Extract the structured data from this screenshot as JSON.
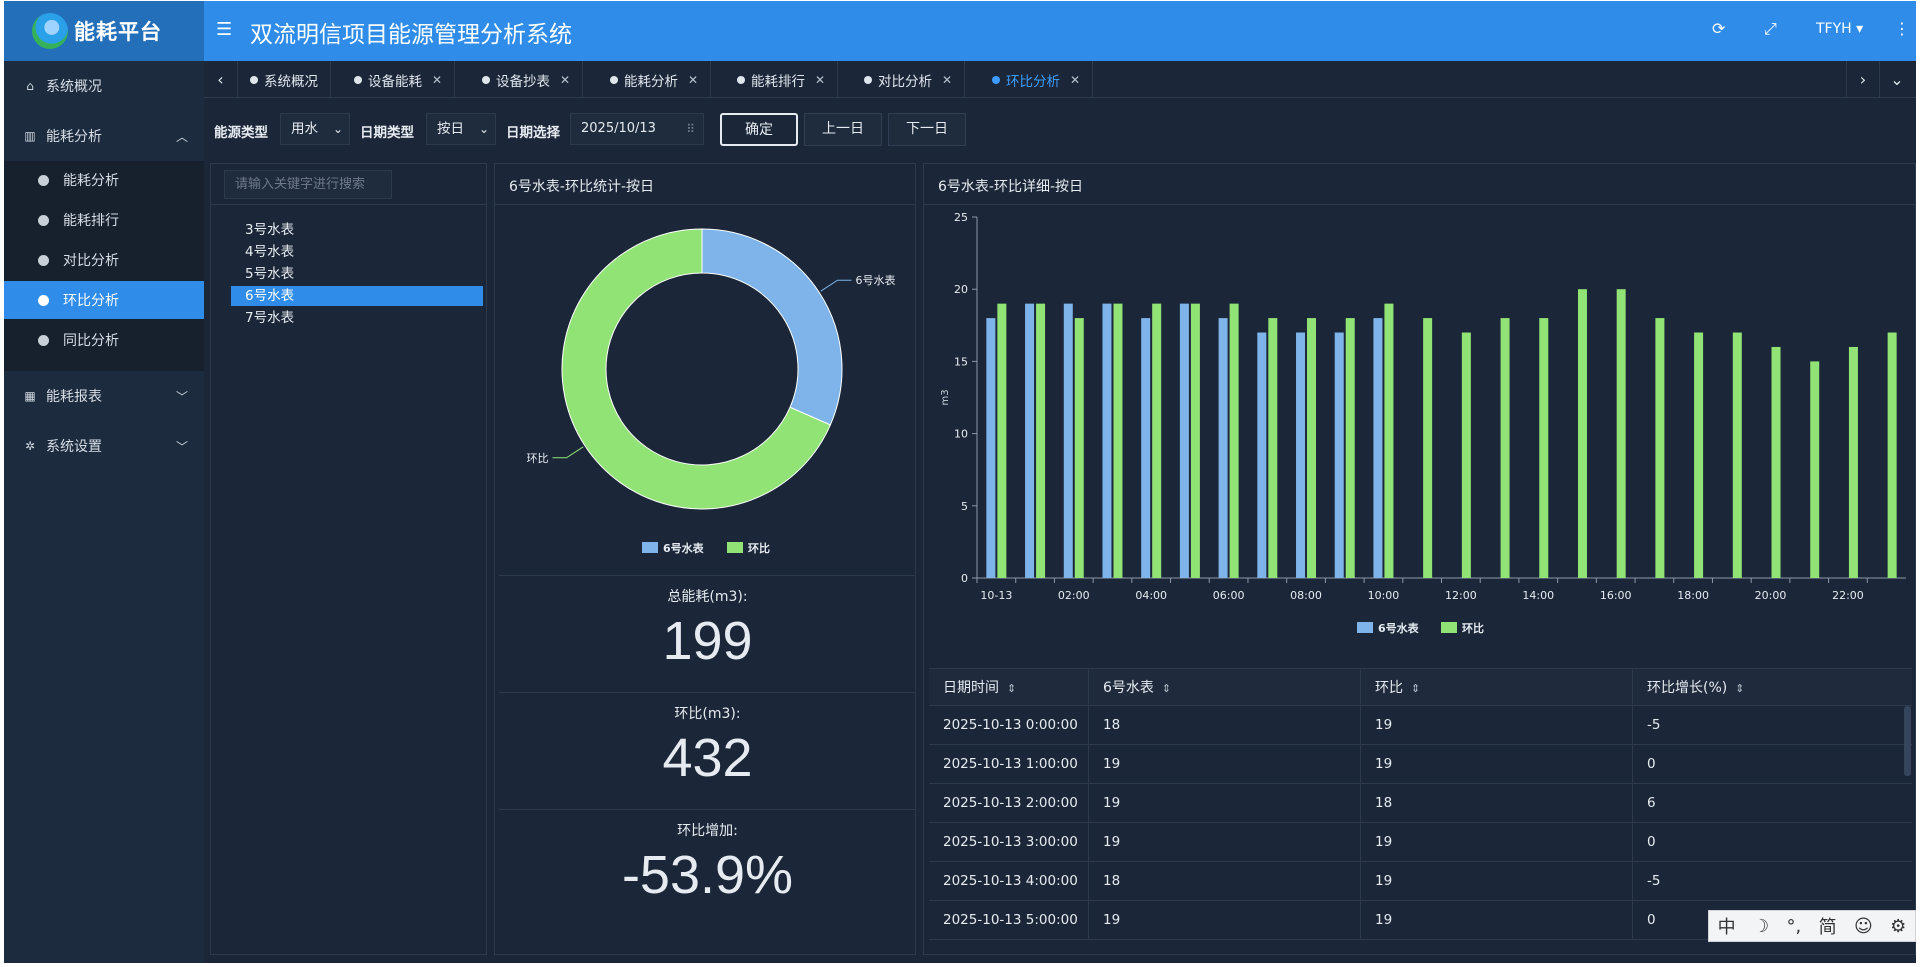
{
  "header": {
    "logo_text": "能耗平台",
    "title": "双流明信项目能源管理分析系统",
    "user": "TFYH",
    "icons": [
      "menu-icon",
      "refresh-icon",
      "fullscreen-icon",
      "more-icon"
    ]
  },
  "sidebar": {
    "items": [
      {
        "label": "系统概况",
        "icon": "home-icon"
      },
      {
        "label": "能耗分析",
        "icon": "bar-chart-icon",
        "expanded": true
      },
      {
        "label": "能耗报表",
        "icon": "table-icon"
      },
      {
        "label": "系统设置",
        "icon": "gear-icon"
      }
    ],
    "sub_items": [
      {
        "label": "能耗分析"
      },
      {
        "label": "能耗排行"
      },
      {
        "label": "对比分析"
      },
      {
        "label": "环比分析",
        "active": true
      },
      {
        "label": "同比分析"
      }
    ]
  },
  "tabs": [
    {
      "label": "系统概况",
      "closable": false
    },
    {
      "label": "设备能耗",
      "closable": true
    },
    {
      "label": "设备抄表",
      "closable": true
    },
    {
      "label": "能耗分析",
      "closable": true
    },
    {
      "label": "能耗排行",
      "closable": true
    },
    {
      "label": "对比分析",
      "closable": true
    },
    {
      "label": "环比分析",
      "closable": true,
      "active": true
    }
  ],
  "filters": {
    "energy_type_label": "能源类型",
    "energy_type_value": "用水",
    "date_type_label": "日期类型",
    "date_type_value": "按日",
    "date_select_label": "日期选择",
    "date_value": "2025/10/13",
    "confirm": "确定",
    "prev_day": "上一日",
    "next_day": "下一日"
  },
  "tree": {
    "search_placeholder": "请输入关键字进行搜索",
    "meters": [
      "3号水表",
      "4号水表",
      "5号水表",
      "6号水表",
      "7号水表"
    ],
    "selected": "6号水表"
  },
  "summary_panel": {
    "title": "6号水表-环比统计-按日",
    "total_label": "总能耗(m3):",
    "total_value": "199",
    "mom_label": "环比(m3):",
    "mom_value": "432",
    "increase_label": "环比增加:",
    "increase_value": "-53.9%"
  },
  "detail_panel": {
    "title": "6号水表-环比详细-按日"
  },
  "colors": {
    "series_current": "#7eb4ea",
    "series_mom": "#92e376",
    "accent": "#2f8ce9"
  },
  "chart_data": [
    {
      "type": "pie",
      "donut": true,
      "slices": [
        {
          "name": "6号水表",
          "value": 199
        },
        {
          "name": "环比",
          "value": 432
        }
      ],
      "legend": [
        "6号水表",
        "环比"
      ],
      "legend_position": "bottom"
    },
    {
      "type": "bar",
      "ylabel": "m3",
      "ylim": [
        0,
        25
      ],
      "yticks": [
        0,
        5,
        10,
        15,
        20,
        25
      ],
      "categories": [
        "10-13",
        "01:00",
        "02:00",
        "03:00",
        "04:00",
        "05:00",
        "06:00",
        "07:00",
        "08:00",
        "09:00",
        "10:00",
        "11:00",
        "12:00",
        "13:00",
        "14:00",
        "15:00",
        "16:00",
        "17:00",
        "18:00",
        "19:00",
        "20:00",
        "21:00",
        "22:00",
        "23:00"
      ],
      "xtick_labels": [
        "10-13",
        "02:00",
        "04:00",
        "06:00",
        "08:00",
        "10:00",
        "12:00",
        "14:00",
        "16:00",
        "18:00",
        "20:00",
        "22:00"
      ],
      "series": [
        {
          "name": "6号水表",
          "values": [
            18,
            19,
            19,
            19,
            18,
            19,
            18,
            17,
            17,
            17,
            18,
            null,
            null,
            null,
            null,
            null,
            null,
            null,
            null,
            null,
            null,
            null,
            null,
            null
          ]
        },
        {
          "name": "环比",
          "values": [
            19,
            19,
            18,
            19,
            19,
            19,
            19,
            18,
            18,
            18,
            19,
            18,
            17,
            18,
            18,
            20,
            20,
            18,
            17,
            17,
            16,
            15,
            16,
            17
          ]
        }
      ],
      "legend_position": "bottom"
    }
  ],
  "table": {
    "columns": [
      "日期时间",
      "6号水表",
      "环比",
      "环比增长(%)"
    ],
    "rows": [
      [
        "2025-10-13 0:00:00",
        "18",
        "19",
        "-5"
      ],
      [
        "2025-10-13 1:00:00",
        "19",
        "19",
        "0"
      ],
      [
        "2025-10-13 2:00:00",
        "19",
        "18",
        "6"
      ],
      [
        "2025-10-13 3:00:00",
        "19",
        "19",
        "0"
      ],
      [
        "2025-10-13 4:00:00",
        "18",
        "19",
        "-5"
      ],
      [
        "2025-10-13 5:00:00",
        "19",
        "19",
        "0"
      ]
    ]
  },
  "ime_toolbar": [
    "中",
    "☽",
    "°,",
    "简",
    "☺",
    "⚙"
  ]
}
